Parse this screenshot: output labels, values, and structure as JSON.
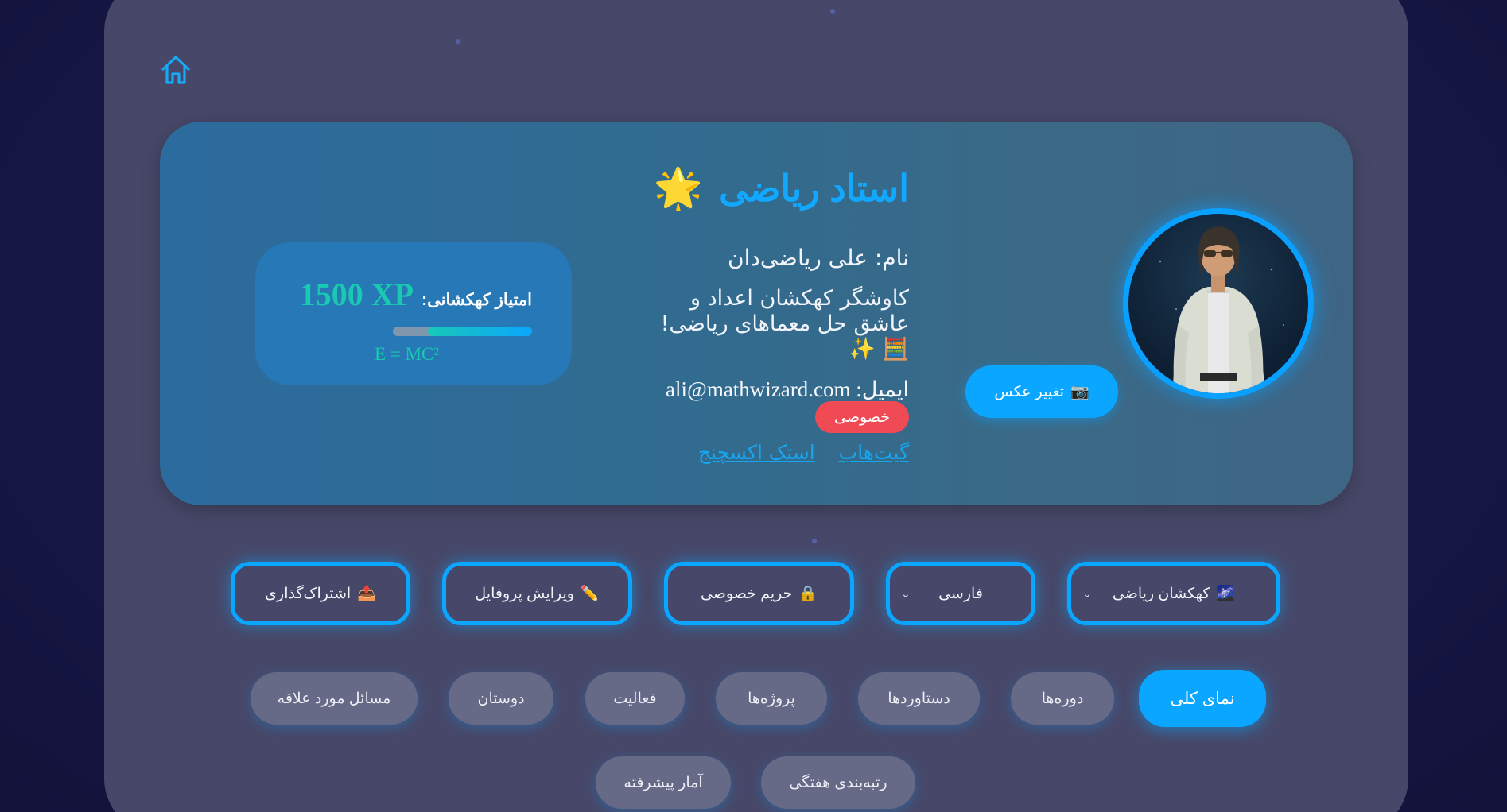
{
  "nav": {
    "home_icon": "home-icon"
  },
  "profile": {
    "title": "استاد ریاضی",
    "title_emoji": "🌟",
    "name_label": "نام:",
    "name_value": "علی ریاضی‌دان",
    "bio_line1": "کاوشگر کهکشان اعداد و",
    "bio_line2": "عاشق حل معماهای ریاضی!",
    "bio_emojis": "🧮 ✨",
    "email_label": "ایمیل:",
    "email_value": "ali@mathwizard.com",
    "private_badge": "خصوصی",
    "links": [
      "گیت‌هاب",
      "استک اکسچنج"
    ],
    "change_photo_icon": "📷",
    "change_photo_label": "تغییر عکس"
  },
  "xp": {
    "label": "امتیاز کهکشانی:",
    "value": "1500 XP",
    "progress": 0.75,
    "formula": "E = MC²"
  },
  "controls": {
    "galaxy_select": {
      "icon": "🌌",
      "value": "کهکشان ریاضی"
    },
    "language_select": {
      "value": "فارسی"
    },
    "privacy_button": {
      "icon": "🔒",
      "label": "حریم خصوصی"
    },
    "edit_button": {
      "icon": "✏️",
      "label": "ویرایش پروفایل"
    },
    "share_button": {
      "icon": "📤",
      "label": "اشتراک‌گذاری"
    }
  },
  "tabs": [
    {
      "label": "نمای کلی",
      "active": true
    },
    {
      "label": "دوره‌ها",
      "active": false
    },
    {
      "label": "دستاوردها",
      "active": false
    },
    {
      "label": "پروژه‌ها",
      "active": false
    },
    {
      "label": "فعالیت",
      "active": false
    },
    {
      "label": "دوستان",
      "active": false
    },
    {
      "label": "مسائل مورد علاقه",
      "active": false
    },
    {
      "label": "رتبه‌بندی هفتگی",
      "active": false
    },
    {
      "label": "آمار پیشرفته",
      "active": false
    }
  ],
  "colors": {
    "accent": "#0aa6ff",
    "panel": "#474869",
    "danger": "#f04b55",
    "xp": "#19c9b0"
  }
}
